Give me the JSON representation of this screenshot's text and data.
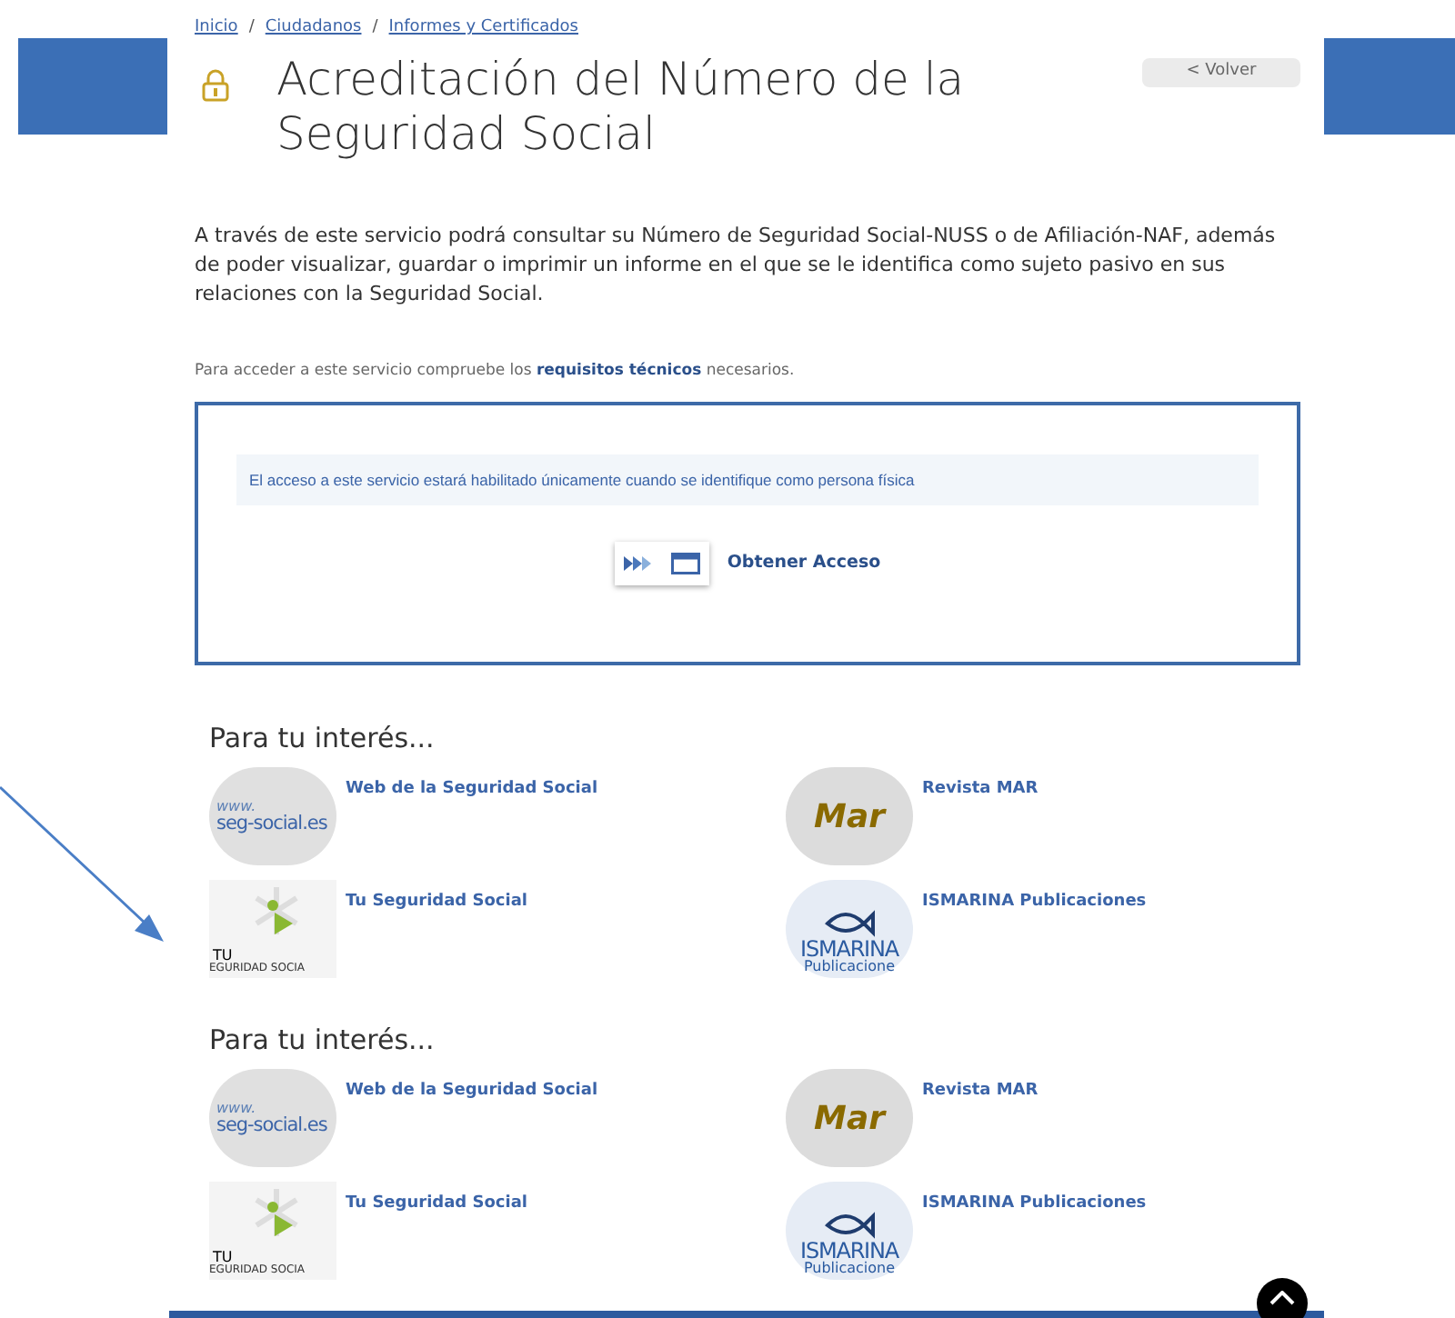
{
  "breadcrumb": [
    "Inicio",
    "Ciudadanos",
    "Informes y Certificados"
  ],
  "breadcrumb_separator": "/",
  "title": "Acreditación del Número de la Seguridad Social",
  "back_button": "< Volver",
  "intro": "A través de este servicio podrá consultar su Número de Seguridad Social-NUSS o de Afiliación-NAF, además de poder visualizar, guardar o imprimir un informe en el que se le identifica como sujeto pasivo en sus relaciones con la Seguridad Social.",
  "requirements_note": "Para acceder a este servicio compruebe los **requisitos técnicos** necesarios.",
  "access_box": {
    "notice": "El acceso a este servicio estará habilitado únicamente cuando se identifique como persona física",
    "button": "Obtener Acceso"
  },
  "sections": [
    {
      "heading": "Para tu interés...",
      "links": [
        {
          "kind": "web",
          "label": "Web de la Seguridad Social",
          "logo_text": [
            "www.",
            "seg-social.es"
          ]
        },
        {
          "kind": "mar",
          "label": "Revista MAR",
          "logo_text": [
            "Mar"
          ]
        },
        {
          "kind": "tu",
          "label": "Tu Seguridad Social",
          "logo_text": [
            "TU",
            "EGURIDAD SOCIA"
          ]
        },
        {
          "kind": "ismarina",
          "label": "ISMARINA Publicaciones",
          "logo_text": [
            "ISMARINA",
            "Publicacione"
          ]
        }
      ]
    },
    {
      "heading": "Para tu interés...",
      "links": [
        {
          "kind": "web",
          "label": "Web de la Seguridad Social",
          "logo_text": [
            "www.",
            "seg-social.es"
          ]
        },
        {
          "kind": "mar",
          "label": "Revista MAR",
          "logo_text": [
            "Mar"
          ]
        },
        {
          "kind": "tu",
          "label": "Tu Seguridad Social",
          "logo_text": [
            "TU",
            "EGURIDAD SOCIA"
          ]
        },
        {
          "kind": "ismarina",
          "label": "ISMARINA Publicaciones",
          "logo_text": [
            "ISMARINA",
            "Publicacione"
          ]
        }
      ]
    }
  ]
}
